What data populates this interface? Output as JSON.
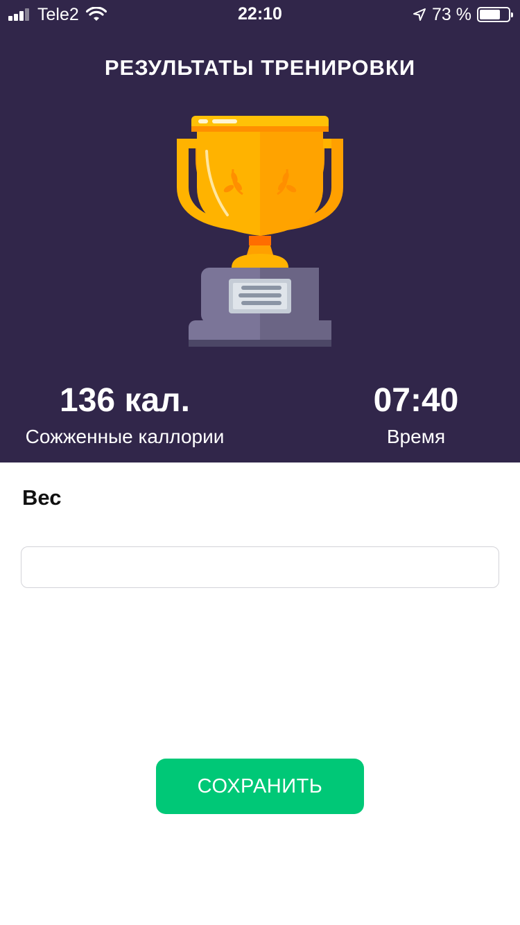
{
  "status_bar": {
    "carrier": "Tele2",
    "time": "22:10",
    "battery_percent": "73 %",
    "battery_level": 0.73,
    "icons": [
      "signal-icon",
      "wifi-icon",
      "location-arrow-icon",
      "battery-icon"
    ]
  },
  "header": {
    "title": "РЕЗУЛЬТАТЫ ТРЕНИРОВКИ",
    "image": "trophy-icon"
  },
  "stats": {
    "calories": {
      "value": "136 кал.",
      "label": "Сожженные каллории"
    },
    "time": {
      "value": "07:40",
      "label": "Время"
    }
  },
  "form": {
    "weight_label": "Вес",
    "weight_value": "",
    "weight_placeholder": ""
  },
  "save_button": {
    "label": "СОХРАНИТЬ"
  },
  "colors": {
    "header_bg": "#31264a",
    "accent_green": "#00c877",
    "trophy_gold": "#ffb300",
    "trophy_base": "#6b6585"
  }
}
